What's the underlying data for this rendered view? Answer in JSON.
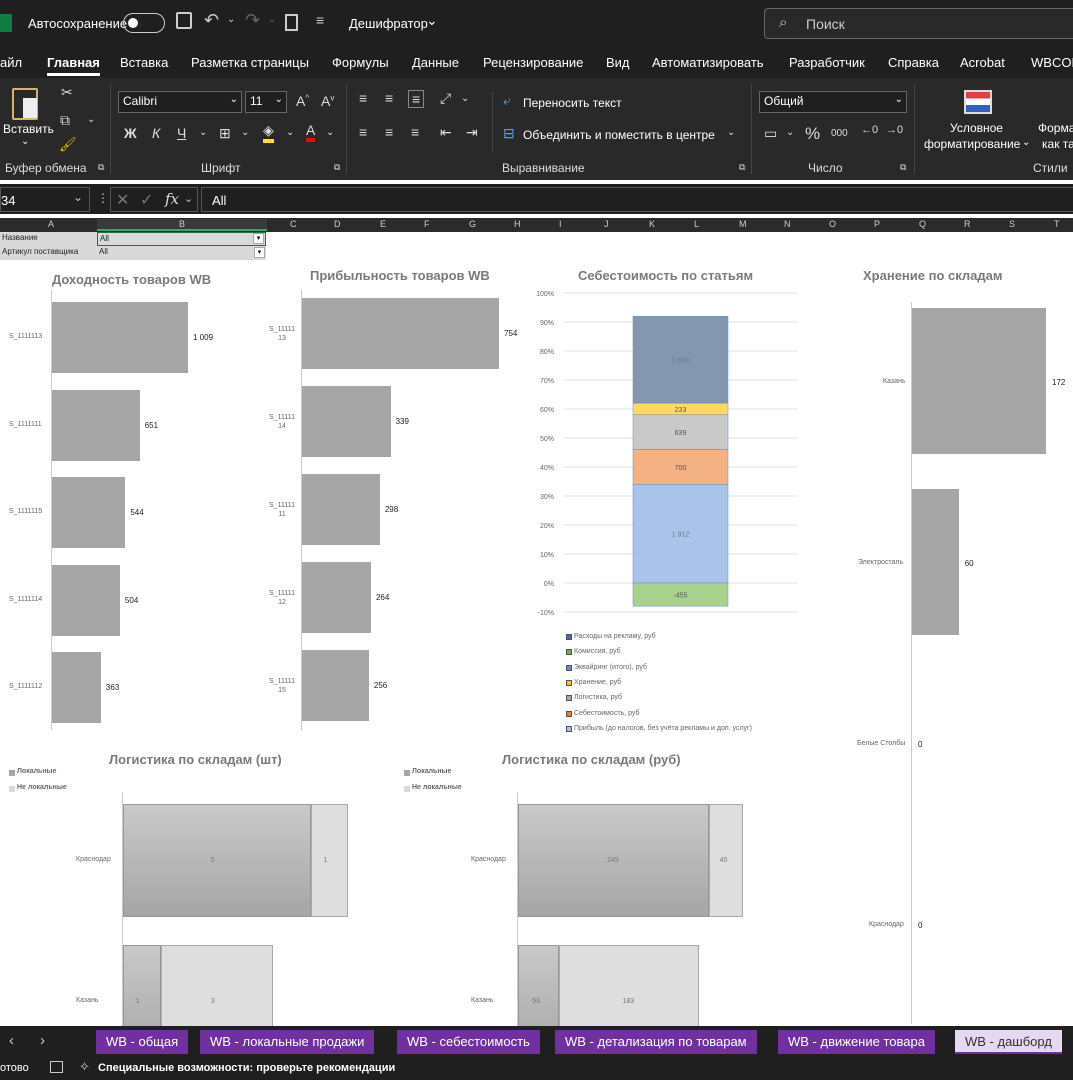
{
  "titlebar": {
    "autosave": "Автосохранение",
    "doc_name": "Дешифратор",
    "search": "Поиск"
  },
  "menu": [
    "айл",
    "Главная",
    "Вставка",
    "Разметка страницы",
    "Формулы",
    "Данные",
    "Рецензирование",
    "Вид",
    "Автоматизировать",
    "Разработчик",
    "Справка",
    "Acrobat",
    "WBCON"
  ],
  "ribbon": {
    "paste": "Вставить",
    "clipboard": "Буфер обмена",
    "font_name": "Calibri",
    "font_size": "11",
    "font_group": "Шрифт",
    "bold": "Ж",
    "italic": "К",
    "underline": "Ч",
    "wrap": "Переносить текст",
    "merge": "Объединить и поместить в центре",
    "align_group": "Выравнивание",
    "number_format": "Общий",
    "number_group": "Число",
    "percent": "%",
    "thousands": "000",
    "cond_format_1": "Условное",
    "cond_format_2": "форматирование",
    "format_table_1": "Форма",
    "format_table_2": "как та",
    "styles_group": "Стили"
  },
  "formula_bar": {
    "cell_ref": "34",
    "content": "All"
  },
  "columns": [
    "A",
    "B",
    "C",
    "D",
    "E",
    "F",
    "G",
    "H",
    "I",
    "J",
    "K",
    "L",
    "M",
    "N",
    "O",
    "P",
    "Q",
    "R",
    "S",
    "T"
  ],
  "filters": [
    {
      "label": "Название",
      "value": "All"
    },
    {
      "label": "Артикул поставщика",
      "value": "All"
    }
  ],
  "colors": {
    "bar": "#a6a6a6",
    "stack": [
      "#8497b0",
      "#ffd966",
      "#c9c9c9",
      "#f4b183",
      "#a9c4e8",
      "#a9d18e"
    ],
    "tab": "#7030a0"
  },
  "chart_data": [
    {
      "type": "bar",
      "title": "Доходность товаров WB",
      "categories": [
        "S_1111113",
        "S_1111111",
        "S_1111115",
        "S_1111114",
        "S_1111112"
      ],
      "values": [
        1009,
        651,
        544,
        504,
        363
      ],
      "labels": [
        "1 009",
        "651",
        "544",
        "504",
        "363"
      ]
    },
    {
      "type": "bar",
      "title": "Прибыльность товаров WB",
      "categories": [
        "S_11111 13",
        "S_11111 14",
        "S_11111 11",
        "S_11111 12",
        "S_11111 15"
      ],
      "values": [
        754,
        339,
        298,
        264,
        256
      ]
    },
    {
      "type": "bar",
      "title": "Себестоимость по статьям",
      "stacked": true,
      "ylim": [
        -10,
        100
      ],
      "yticks": [
        "100%",
        "90%",
        "80%",
        "70%",
        "60%",
        "50%",
        "40%",
        "30%",
        "20%",
        "10%",
        "0%",
        "-10%"
      ],
      "segments": [
        {
          "name": "Расходы на рекламу, руб",
          "value": "1 684"
        },
        {
          "name": "Хранение, руб",
          "value": "233"
        },
        {
          "name": "Логистика, руб",
          "value": "639"
        },
        {
          "name": "Себестоимость, руб",
          "value": "700"
        },
        {
          "name": "Прибыль (до налогов, без учёта рекламы и доп. услуг)",
          "value": "1 912"
        },
        {
          "name": "Комиссия, руб",
          "value": "-455"
        }
      ],
      "legend": [
        "Расходы на рекламу, руб",
        "Комиссия, руб",
        "Эквайринг (итого), руб",
        "Хранение, руб",
        "Логистика, руб",
        "Себестоимость, руб",
        "Прибыль (до налогов, без учёта рекламы и доп. услуг)"
      ]
    },
    {
      "type": "bar",
      "title": "Хранение по складам",
      "categories": [
        "Казань",
        "Электросталь",
        "Белые Столбы",
        "Краснодар"
      ],
      "values": [
        172,
        60,
        0,
        0
      ]
    },
    {
      "type": "bar",
      "title": "Логистика по складам (шт)",
      "stacked": true,
      "legend": [
        "Локальные",
        "Не локальные"
      ],
      "categories": [
        "Краснодар",
        "Казань"
      ],
      "series": [
        {
          "name": "Локальные",
          "values": [
            5,
            1
          ]
        },
        {
          "name": "Не локальные",
          "values": [
            1,
            3
          ]
        }
      ]
    },
    {
      "type": "bar",
      "title": "Логистика по складам (руб)",
      "stacked": true,
      "legend": [
        "Локальные",
        "Не локальные"
      ],
      "categories": [
        "Краснодар",
        "Казань"
      ],
      "series": [
        {
          "name": "Локальные",
          "values": [
            249,
            53
          ]
        },
        {
          "name": "Не локальные",
          "values": [
            45,
            183
          ]
        }
      ]
    }
  ],
  "tabs": [
    "WB - общая",
    "WB - локальные продажи",
    "WB - себестоимость",
    "WB - детализация по товарам",
    "WB - движение товара",
    "WB - дашборд"
  ],
  "status": {
    "ready": "отово",
    "accessibility": "Специальные возможности: проверьте рекомендации"
  }
}
